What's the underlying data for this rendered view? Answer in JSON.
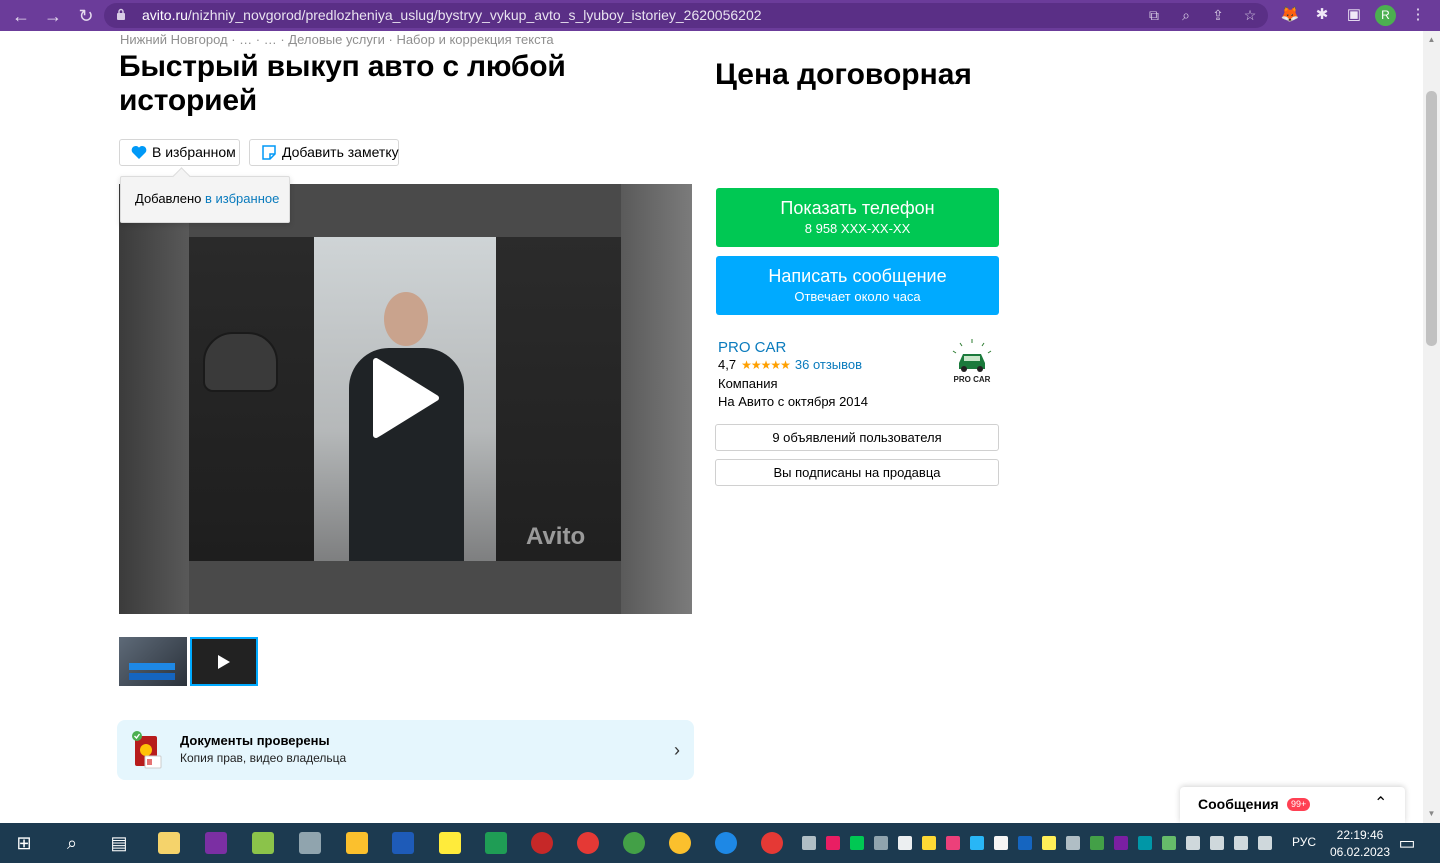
{
  "browser": {
    "url_host": "avito.ru",
    "url_path": "/nizhniy_novgorod/predlozheniya_uslug/bystryy_vykup_avto_s_lyuboy_istoriey_2620056202",
    "profile_initial": "R"
  },
  "breadcrumb": "Нижний Новгород · … · … · Деловые услуги · Набор и коррекция текста",
  "listing": {
    "title": "Быстрый выкуп авто с любой историей",
    "price": "Цена договорная",
    "favorite_label": "В избранном",
    "note_label": "Добавить заметку",
    "tooltip_prefix": "Добавлено ",
    "tooltip_link": "в избранное",
    "watermark": "Avito"
  },
  "docs": {
    "title": "Документы проверены",
    "subtitle": "Копия прав, видео владельца"
  },
  "contact": {
    "phone_label": "Показать телефон",
    "phone_number": "8 958 XXX-XX-XX",
    "message_label": "Написать сообщение",
    "message_sub": "Отвечает около часа"
  },
  "seller": {
    "name": "PRO CAR",
    "rating": "4,7",
    "stars": "★★★★★",
    "reviews": "36 отзывов",
    "type": "Компания",
    "since": "На Авито с октября 2014",
    "logo_text": "PRO CAR",
    "listings_button": "9 объявлений пользователя",
    "subscribed_button": "Вы подписаны на продавца"
  },
  "messages": {
    "label": "Сообщения",
    "badge": "99+"
  },
  "taskbar": {
    "lang": "РУС",
    "time": "22:19:46",
    "date": "06.02.2023"
  },
  "colors": {
    "browser_frame": "#6b3c9a",
    "phone_button": "#00c853",
    "message_button": "#00aaff",
    "link": "#0a7bbd",
    "docs_bg": "#e5f6fd",
    "taskbar": "#1c3a50"
  }
}
